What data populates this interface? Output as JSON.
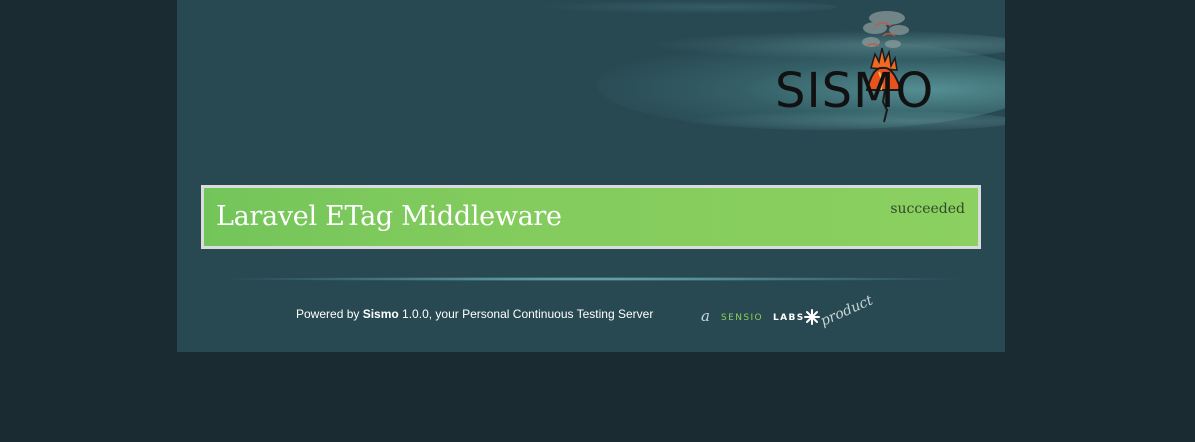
{
  "header": {
    "logo_text": "SISMO"
  },
  "project": {
    "name": "Laravel ETag Middleware",
    "status": "succeeded"
  },
  "footer": {
    "prefix": "Powered by ",
    "app_name": "Sismo",
    "suffix": " 1.0.0, your Personal Continuous Testing Server",
    "vendor_a": "a",
    "vendor_sensio": "SENSIO",
    "vendor_labs": "LABS",
    "vendor_product": "product"
  },
  "colors": {
    "page_bg": "#1a2b32",
    "container_bg": "#284952",
    "success_green": "#82cb5d",
    "box_border": "#d8dcdc",
    "logo_orange": "#e8521c"
  }
}
